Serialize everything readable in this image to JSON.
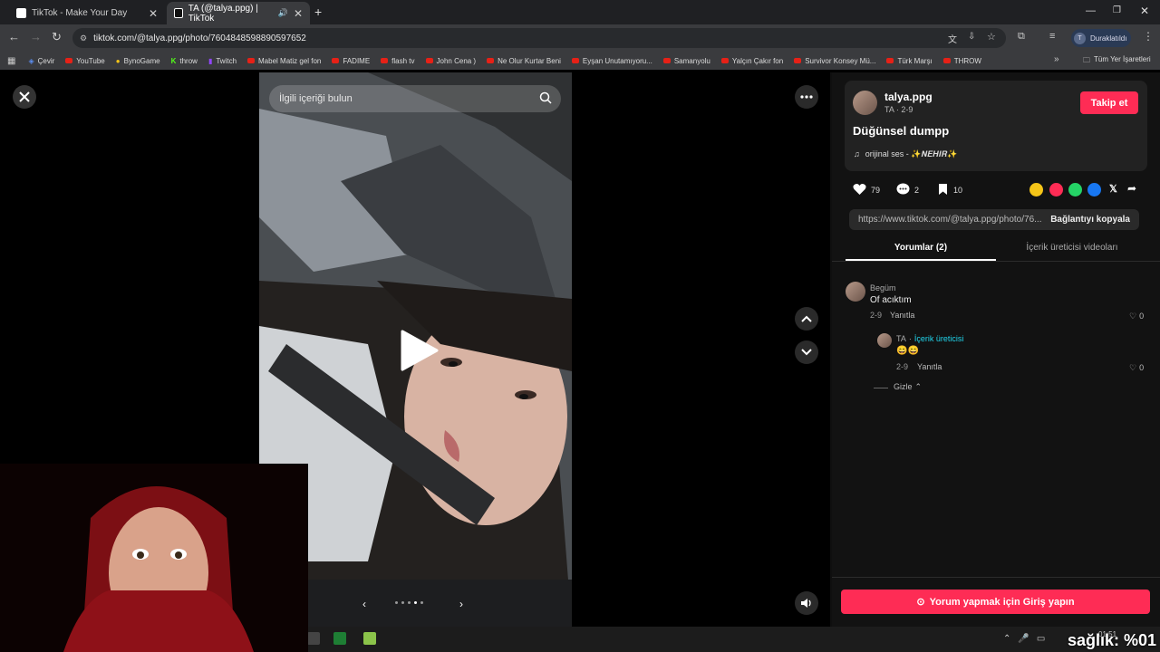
{
  "browser": {
    "tabs": [
      {
        "title": "TikTok - Make Your Day",
        "active": false,
        "close": "✕"
      },
      {
        "title": "TA (@talya.ppg) | TikTok",
        "active": true,
        "close": "✕"
      }
    ],
    "new_tab": "+",
    "url": "tiktok.com/@talya.ppg/photo/7604848598890597652",
    "profile_label": "Duraklatıldı",
    "profile_initial": "T",
    "bookmarks": [
      "Çevir",
      "YouTube",
      "BynoGame",
      "throw",
      "Twitch",
      "Mabel Matiz  gel fon",
      "FADIME",
      "flash tv",
      "John Cena )",
      "Ne Olur Kurtar Beni",
      "Eyşan Unutamıyoru...",
      "Samanyolu",
      "Yalçın Çakır  fon",
      "Survivor Konsey Mü...",
      "Türk Marşı",
      "THROW"
    ],
    "bookmarks_more": "»",
    "all_bookmarks": "Tüm Yer İşaretleri"
  },
  "viewer": {
    "search_placeholder": "İlgili içeriği bulun",
    "carousel_dots": 5
  },
  "post": {
    "username": "talya.ppg",
    "meta": "TA · 2-9",
    "follow_label": "Takip et",
    "caption": "Düğünsel dumpp",
    "sound": "orijinal ses - ✨𝑵𝑬𝑯𝑰𝑹✨",
    "likes": "79",
    "comments": "2",
    "saves": "10",
    "link": "https://www.tiktok.com/@talya.ppg/photo/76...",
    "copy_link": "Bağlantıyı kopyala",
    "tab_comments": "Yorumlar (2)",
    "tab_creator": "İçerik üreticisi videoları"
  },
  "comments": [
    {
      "author": "Begüm",
      "text": "Of acıktım",
      "date": "2-9",
      "reply": "Yanıtla",
      "likes": "0"
    },
    {
      "author": "TA",
      "creator_tag": "İçerik üreticisi",
      "text": "😄😄",
      "date": "2-9",
      "reply": "Yanıtla",
      "likes": "0"
    }
  ],
  "hide_label": "Gizle",
  "login_label": "Yorum yapmak için Giriş yapın",
  "overlay": {
    "text": "sağlık: %01",
    "clock": "01:51"
  },
  "colors": {
    "accent": "#fe2c55",
    "creator": "#20d5ec"
  }
}
